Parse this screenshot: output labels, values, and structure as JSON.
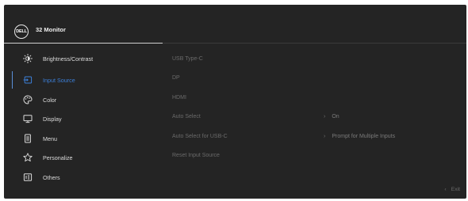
{
  "header": {
    "logo_text": "DELL",
    "title": "32 Monitor"
  },
  "nav": {
    "items": [
      {
        "label": "Brightness/Contrast",
        "icon": "brightness-icon"
      },
      {
        "label": "Input Source",
        "icon": "input-source-icon",
        "active": true
      },
      {
        "label": "Color",
        "icon": "color-palette-icon"
      },
      {
        "label": "Display",
        "icon": "display-icon"
      },
      {
        "label": "Menu",
        "icon": "menu-icon"
      },
      {
        "label": "Personalize",
        "icon": "star-icon"
      },
      {
        "label": "Others",
        "icon": "others-icon"
      }
    ]
  },
  "options": {
    "items": [
      {
        "label": "USB Type-C"
      },
      {
        "label": "DP"
      },
      {
        "label": "HDMI"
      },
      {
        "label": "Auto Select",
        "value": "On"
      },
      {
        "label": "Auto Select for USB-C",
        "value": "Prompt for Multiple Inputs"
      },
      {
        "label": "Reset Input Source"
      }
    ]
  },
  "footer": {
    "exit_label": "Exit"
  },
  "colors": {
    "panel": "#242424",
    "active": "#3c7fd8",
    "text": "#dcdcdc",
    "muted": "#6a6a6a"
  }
}
